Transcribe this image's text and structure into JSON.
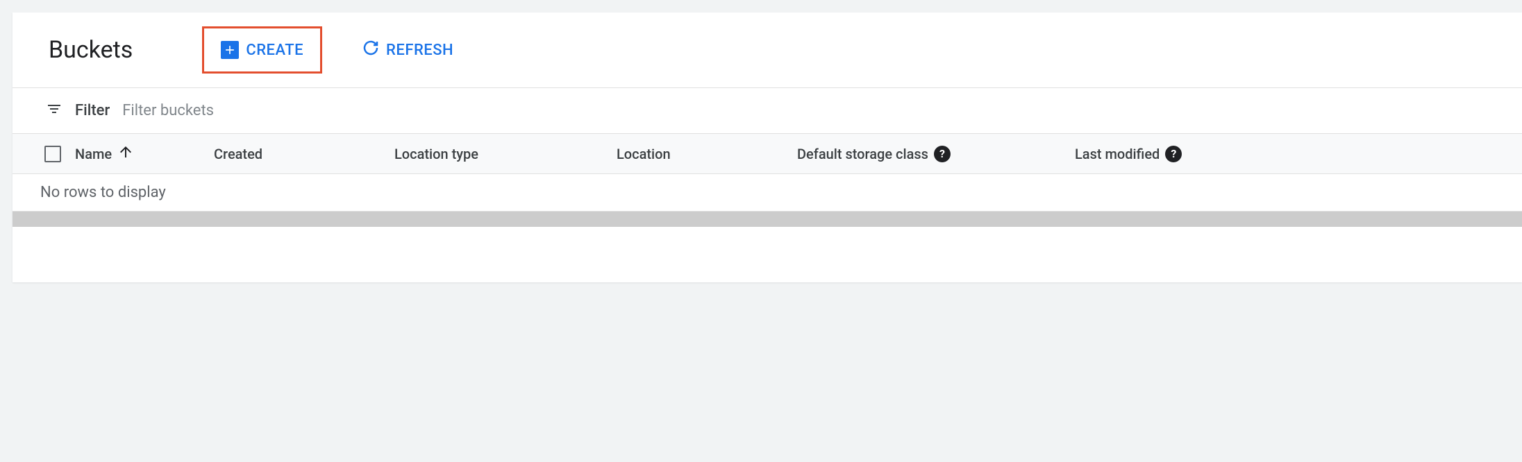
{
  "header": {
    "title": "Buckets",
    "create_label": "CREATE",
    "refresh_label": "REFRESH"
  },
  "filter": {
    "label": "Filter",
    "placeholder": "Filter buckets"
  },
  "table": {
    "columns": {
      "name": "Name",
      "created": "Created",
      "location_type": "Location type",
      "location": "Location",
      "default_storage_class": "Default storage class",
      "last_modified": "Last modified"
    },
    "sort": {
      "column": "name",
      "direction": "asc"
    },
    "rows": [],
    "empty_message": "No rows to display"
  }
}
